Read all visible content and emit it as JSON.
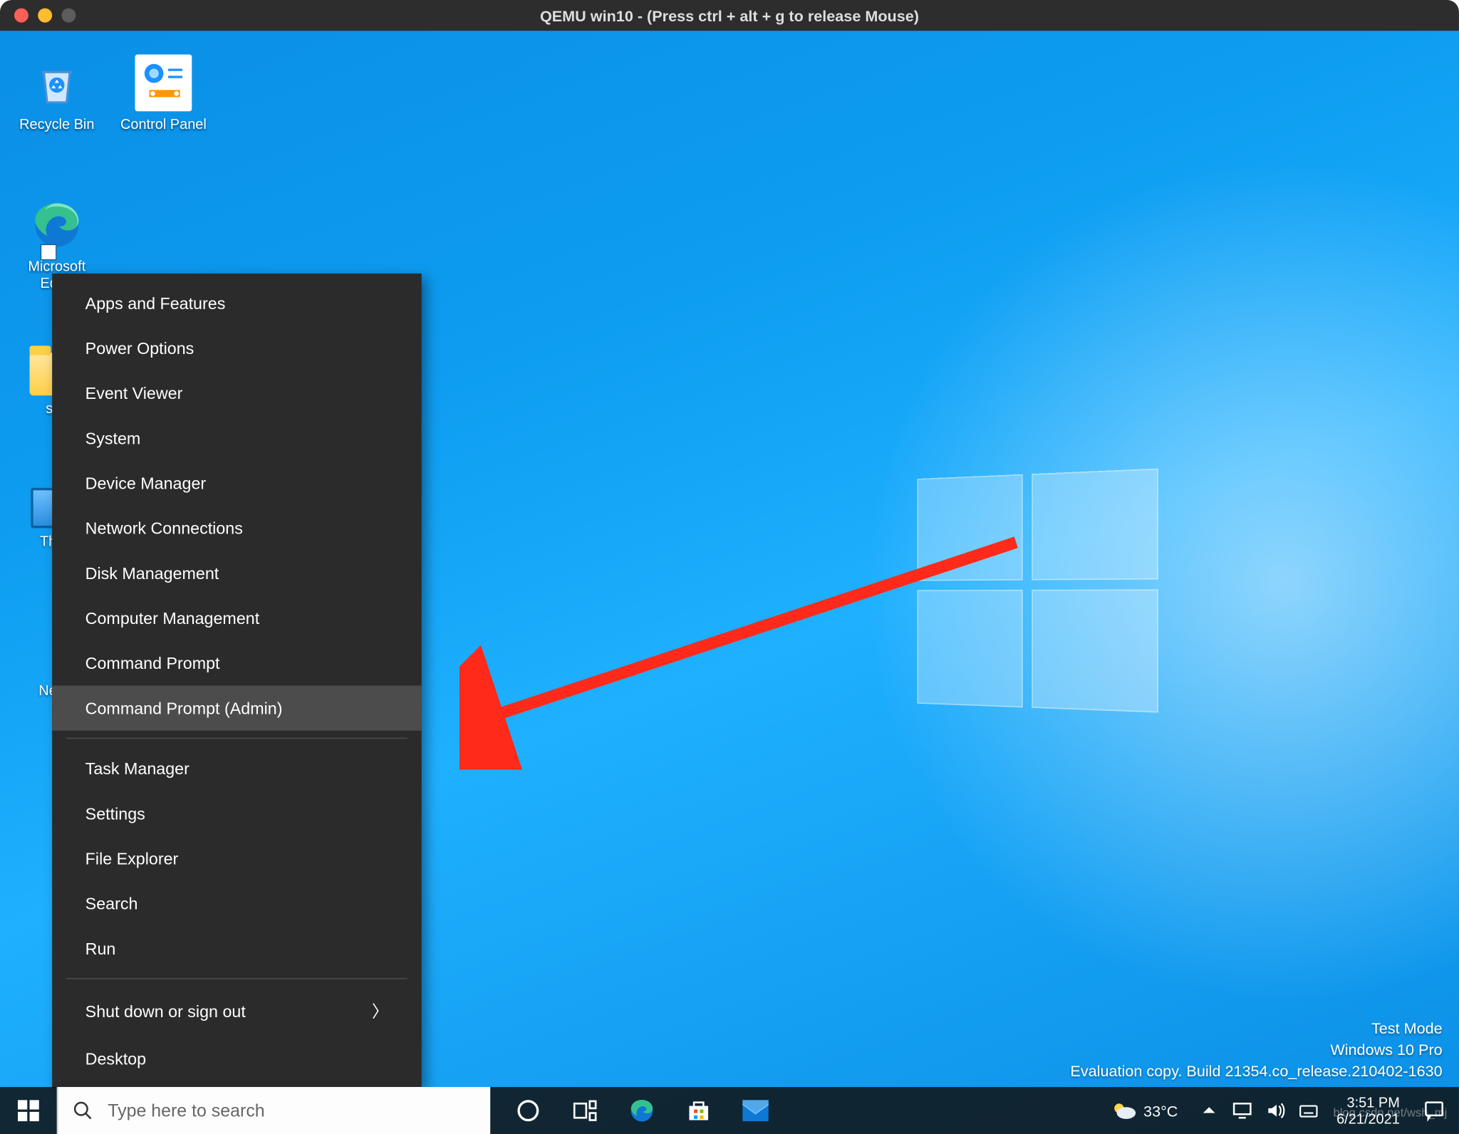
{
  "titlebar": {
    "text": "QEMU win10 - (Press ctrl + alt + g to release Mouse)"
  },
  "desktop_icons": {
    "recycle": "Recycle Bin",
    "cpanel": "Control Panel",
    "edge": "Microsoft Edge",
    "sim": "sim",
    "thispc": "This PC",
    "net": "Network"
  },
  "winx": {
    "group1": [
      "Apps and Features",
      "Power Options",
      "Event Viewer",
      "System",
      "Device Manager",
      "Network Connections",
      "Disk Management",
      "Computer Management",
      "Command Prompt",
      "Command Prompt (Admin)"
    ],
    "group2": [
      "Task Manager",
      "Settings",
      "File Explorer",
      "Search",
      "Run"
    ],
    "group3": [
      "Shut down or sign out",
      "Desktop"
    ],
    "highlighted_index": 9
  },
  "activation": {
    "line1": "Test Mode",
    "line2": "Windows 10 Pro",
    "line3": "Evaluation copy. Build 21354.co_release.210402-1630"
  },
  "taskbar": {
    "search_placeholder": "Type here to search",
    "weather_temp": "33°C",
    "time": "3:51 PM",
    "date": "6/21/2021"
  },
  "watermark": "blog.csdn.net/wsh_mj"
}
